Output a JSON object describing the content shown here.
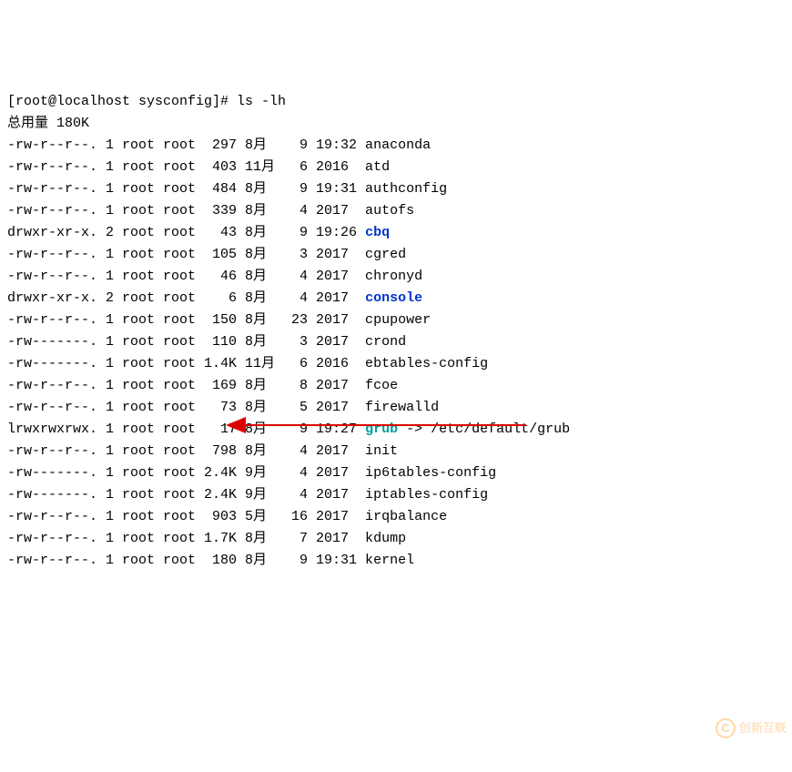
{
  "prompt": {
    "line": "[root@localhost sysconfig]# ls -lh"
  },
  "total": {
    "label": "总用量",
    "value": "180K"
  },
  "files": [
    {
      "perm": "-rw-r--r--.",
      "links": "1",
      "owner": "root",
      "group": "root",
      "size": "297",
      "mon": "8月",
      "day": "9",
      "time": "19:32",
      "name": "anaconda",
      "type": "f"
    },
    {
      "perm": "-rw-r--r--.",
      "links": "1",
      "owner": "root",
      "group": "root",
      "size": "403",
      "mon": "11月",
      "day": "6",
      "time": "2016",
      "name": "atd",
      "type": "f"
    },
    {
      "perm": "-rw-r--r--.",
      "links": "1",
      "owner": "root",
      "group": "root",
      "size": "484",
      "mon": "8月",
      "day": "9",
      "time": "19:31",
      "name": "authconfig",
      "type": "f"
    },
    {
      "perm": "-rw-r--r--.",
      "links": "1",
      "owner": "root",
      "group": "root",
      "size": "339",
      "mon": "8月",
      "day": "4",
      "time": "2017",
      "name": "autofs",
      "type": "f"
    },
    {
      "perm": "drwxr-xr-x.",
      "links": "2",
      "owner": "root",
      "group": "root",
      "size": "43",
      "mon": "8月",
      "day": "9",
      "time": "19:26",
      "name": "cbq",
      "type": "d"
    },
    {
      "perm": "-rw-r--r--.",
      "links": "1",
      "owner": "root",
      "group": "root",
      "size": "105",
      "mon": "8月",
      "day": "3",
      "time": "2017",
      "name": "cgred",
      "type": "f"
    },
    {
      "perm": "-rw-r--r--.",
      "links": "1",
      "owner": "root",
      "group": "root",
      "size": "46",
      "mon": "8月",
      "day": "4",
      "time": "2017",
      "name": "chronyd",
      "type": "f"
    },
    {
      "perm": "drwxr-xr-x.",
      "links": "2",
      "owner": "root",
      "group": "root",
      "size": "6",
      "mon": "8月",
      "day": "4",
      "time": "2017",
      "name": "console",
      "type": "d"
    },
    {
      "perm": "-rw-r--r--.",
      "links": "1",
      "owner": "root",
      "group": "root",
      "size": "150",
      "mon": "8月",
      "day": "23",
      "time": "2017",
      "name": "cpupower",
      "type": "f"
    },
    {
      "perm": "-rw-------.",
      "links": "1",
      "owner": "root",
      "group": "root",
      "size": "110",
      "mon": "8月",
      "day": "3",
      "time": "2017",
      "name": "crond",
      "type": "f"
    },
    {
      "perm": "-rw-------.",
      "links": "1",
      "owner": "root",
      "group": "root",
      "size": "1.4K",
      "mon": "11月",
      "day": "6",
      "time": "2016",
      "name": "ebtables-config",
      "type": "f"
    },
    {
      "perm": "-rw-r--r--.",
      "links": "1",
      "owner": "root",
      "group": "root",
      "size": "169",
      "mon": "8月",
      "day": "8",
      "time": "2017",
      "name": "fcoe",
      "type": "f"
    },
    {
      "perm": "-rw-r--r--.",
      "links": "1",
      "owner": "root",
      "group": "root",
      "size": "73",
      "mon": "8月",
      "day": "5",
      "time": "2017",
      "name": "firewalld",
      "type": "f"
    },
    {
      "perm": "lrwxrwxrwx.",
      "links": "1",
      "owner": "root",
      "group": "root",
      "size": "17",
      "mon": "8月",
      "day": "9",
      "time": "19:27",
      "name": "grub",
      "type": "l",
      "target": "/etc/default/grub"
    },
    {
      "perm": "-rw-r--r--.",
      "links": "1",
      "owner": "root",
      "group": "root",
      "size": "798",
      "mon": "8月",
      "day": "4",
      "time": "2017",
      "name": "init",
      "type": "f"
    },
    {
      "perm": "-rw-------.",
      "links": "1",
      "owner": "root",
      "group": "root",
      "size": "2.4K",
      "mon": "9月",
      "day": "4",
      "time": "2017",
      "name": "ip6tables-config",
      "type": "f"
    },
    {
      "perm": "-rw-------.",
      "links": "1",
      "owner": "root",
      "group": "root",
      "size": "2.4K",
      "mon": "9月",
      "day": "4",
      "time": "2017",
      "name": "iptables-config",
      "type": "f"
    },
    {
      "perm": "-rw-r--r--.",
      "links": "1",
      "owner": "root",
      "group": "root",
      "size": "903",
      "mon": "5月",
      "day": "16",
      "time": "2017",
      "name": "irqbalance",
      "type": "f"
    },
    {
      "perm": "-rw-r--r--.",
      "links": "1",
      "owner": "root",
      "group": "root",
      "size": "1.7K",
      "mon": "8月",
      "day": "7",
      "time": "2017",
      "name": "kdump",
      "type": "f"
    },
    {
      "perm": "-rw-r--r--.",
      "links": "1",
      "owner": "root",
      "group": "root",
      "size": "180",
      "mon": "8月",
      "day": "9",
      "time": "19:31",
      "name": "kernel",
      "type": "f"
    }
  ],
  "link_arrow": " -> ",
  "watermark": {
    "char": "C",
    "text": "创新互联"
  }
}
